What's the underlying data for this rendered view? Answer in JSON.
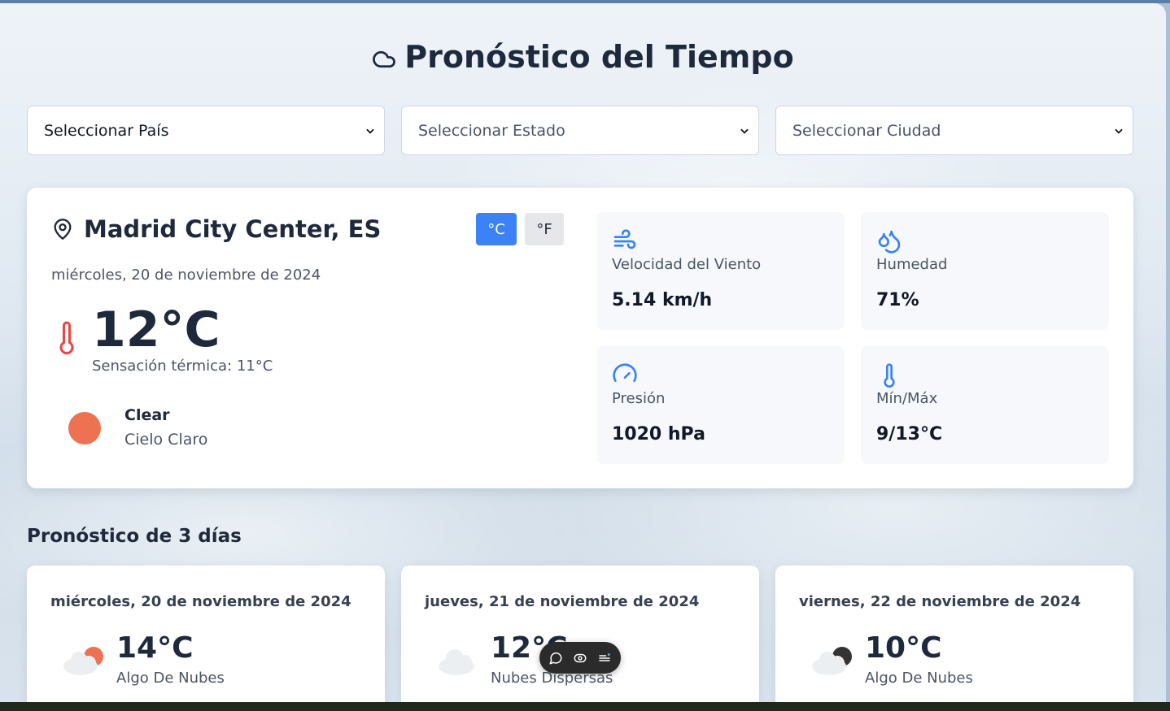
{
  "app": {
    "title": "Pronóstico del Tiempo",
    "title_icon": "cloud-icon"
  },
  "selectors": {
    "country": "Seleccionar País",
    "state": "Seleccionar Estado",
    "city": "Seleccionar Ciudad"
  },
  "current": {
    "location": "Madrid City Center, ES",
    "unit_celsius": "°C",
    "unit_fahrenheit": "°F",
    "active_unit": "celsius",
    "date": "miércoles, 20 de noviembre de 2024",
    "temperature": "12°C",
    "feels_like": "Sensación térmica: 11°C",
    "condition_main": "Clear",
    "condition_desc": "Cielo Claro",
    "condition_color": "#ee7152"
  },
  "stats": [
    {
      "icon": "wind-icon",
      "label": "Velocidad del Viento",
      "value": "5.14 km/h"
    },
    {
      "icon": "droplets-icon",
      "label": "Humedad",
      "value": "71%"
    },
    {
      "icon": "gauge-icon",
      "label": "Presión",
      "value": "1020 hPa"
    },
    {
      "icon": "thermometer-icon",
      "label": "Mín/Máx",
      "value": "9/13°C"
    }
  ],
  "forecast": {
    "title": "Pronóstico de 3 días",
    "days": [
      {
        "date": "miércoles, 20 de noviembre de 2024",
        "temp": "14°C",
        "desc": "Algo De Nubes",
        "icon": "cloud-sun-icon"
      },
      {
        "date": "jueves, 21 de noviembre de 2024",
        "temp": "12°C",
        "desc": "Nubes Dispersas",
        "icon": "cloud-icon"
      },
      {
        "date": "viernes, 22 de noviembre de 2024",
        "temp": "10°C",
        "desc": "Algo De Nubes",
        "icon": "cloud-moon-icon"
      }
    ]
  },
  "colors": {
    "accent": "#3b82f6",
    "icon_blue": "#3b82f6",
    "thermo_red": "#ef4444",
    "text_dark": "#1e293b"
  }
}
